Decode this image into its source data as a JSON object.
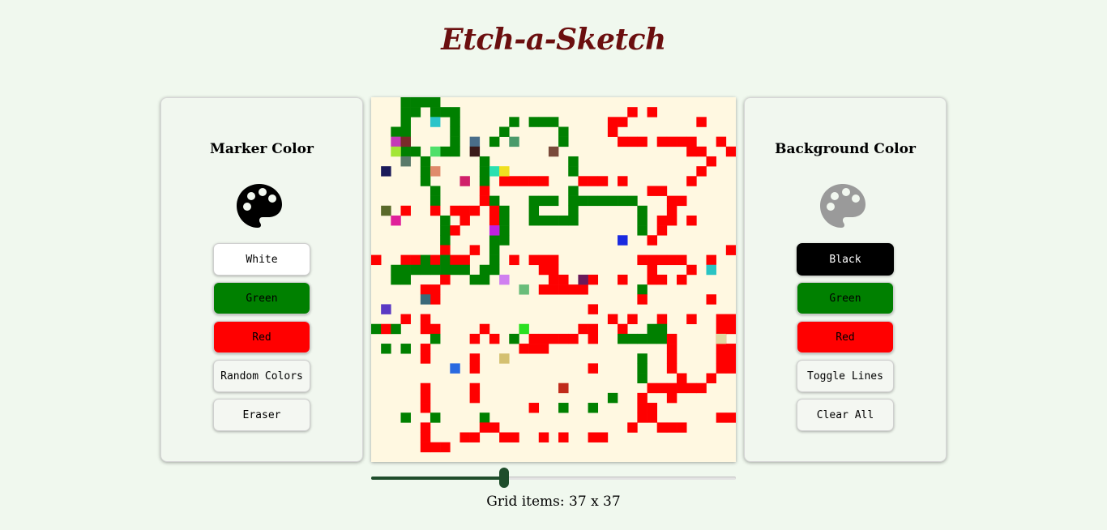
{
  "title": "Etch-a-Sketch",
  "marker_panel": {
    "title": "Marker Color",
    "icon": "palette-icon",
    "icon_color": "#000000",
    "buttons": [
      {
        "label": "White",
        "bg": "#ffffff",
        "fg": "#000000"
      },
      {
        "label": "Green",
        "bg": "#008000",
        "fg": "#000000"
      },
      {
        "label": "Red",
        "bg": "#ff0000",
        "fg": "#000000"
      },
      {
        "label": "Random Colors",
        "bg": "#f4f7f2",
        "fg": "#000000"
      },
      {
        "label": "Eraser",
        "bg": "#f4f7f2",
        "fg": "#000000"
      }
    ]
  },
  "background_panel": {
    "title": "Background Color",
    "icon": "palette-icon",
    "icon_color": "#9a9a9a",
    "buttons": [
      {
        "label": "Black",
        "bg": "#000000",
        "fg": "#ffffff"
      },
      {
        "label": "Green",
        "bg": "#008000",
        "fg": "#000000"
      },
      {
        "label": "Red",
        "bg": "#ff0000",
        "fg": "#000000"
      },
      {
        "label": "Toggle Lines",
        "bg": "#f4f7f2",
        "fg": "#000000"
      },
      {
        "label": "Clear All",
        "bg": "#f4f7f2",
        "fg": "#000000"
      }
    ]
  },
  "canvas": {
    "grid_size": 37,
    "background_color": "#fff8e1",
    "palette": {
      "G": "#008000",
      "R": "#ff0000",
      "W": "#ffffff"
    },
    "painted": [
      [
        0,
        [
          [
            3,
            "GGGG"
          ]
        ]
      ],
      [
        1,
        [
          [
            3,
            "GG"
          ],
          [
            6,
            "GGG"
          ],
          [
            26,
            "R"
          ],
          [
            28,
            "R"
          ]
        ]
      ],
      [
        2,
        [
          [
            3,
            "G"
          ],
          [
            8,
            "G"
          ],
          [
            14,
            "G"
          ],
          [
            16,
            "GGG"
          ],
          [
            24,
            "RR"
          ],
          [
            33,
            "R"
          ]
        ]
      ],
      [
        3,
        [
          [
            2,
            "GG"
          ],
          [
            8,
            "G"
          ],
          [
            13,
            "G"
          ],
          [
            19,
            "G"
          ],
          [
            24,
            "R"
          ]
        ]
      ],
      [
        4,
        [
          [
            3,
            "G"
          ],
          [
            8,
            "G"
          ],
          [
            12,
            "G"
          ],
          [
            19,
            "G"
          ],
          [
            25,
            "RRR"
          ],
          [
            29,
            "RRRR"
          ],
          [
            35,
            "R"
          ]
        ]
      ],
      [
        5,
        [
          [
            3,
            "GG"
          ],
          [
            7,
            "GG"
          ],
          [
            32,
            "RR"
          ],
          [
            36,
            "R"
          ]
        ]
      ],
      [
        6,
        [
          [
            5,
            "G"
          ],
          [
            11,
            "G"
          ],
          [
            20,
            "G"
          ],
          [
            34,
            "R"
          ]
        ]
      ],
      [
        7,
        [
          [
            5,
            "G"
          ],
          [
            11,
            "G"
          ],
          [
            20,
            "G"
          ],
          [
            33,
            "R"
          ]
        ]
      ],
      [
        8,
        [
          [
            5,
            "G"
          ],
          [
            11,
            "G"
          ],
          [
            13,
            "RRRRR"
          ],
          [
            21,
            "RRR"
          ],
          [
            25,
            "R"
          ],
          [
            32,
            "R"
          ]
        ]
      ],
      [
        9,
        [
          [
            6,
            "G"
          ],
          [
            11,
            "R"
          ],
          [
            20,
            "G"
          ],
          [
            28,
            "RR"
          ]
        ]
      ],
      [
        10,
        [
          [
            6,
            "G"
          ],
          [
            11,
            "R"
          ],
          [
            12,
            "G"
          ],
          [
            16,
            "GGG"
          ],
          [
            20,
            "GGGGGGG"
          ],
          [
            30,
            "RR"
          ]
        ]
      ],
      [
        11,
        [
          [
            3,
            "R"
          ],
          [
            6,
            "R"
          ],
          [
            8,
            "RRR"
          ],
          [
            12,
            "R"
          ],
          [
            13,
            "G"
          ],
          [
            16,
            "G"
          ],
          [
            20,
            "G"
          ],
          [
            27,
            "G"
          ],
          [
            30,
            "R"
          ]
        ]
      ],
      [
        12,
        [
          [
            7,
            "G"
          ],
          [
            9,
            "R"
          ],
          [
            12,
            "R"
          ],
          [
            13,
            "G"
          ],
          [
            16,
            "GGGGG"
          ],
          [
            27,
            "G"
          ],
          [
            29,
            "RR"
          ],
          [
            32,
            "R"
          ]
        ]
      ],
      [
        13,
        [
          [
            7,
            "G"
          ],
          [
            8,
            "R"
          ],
          [
            13,
            "G"
          ],
          [
            27,
            "G"
          ],
          [
            29,
            "R"
          ]
        ]
      ],
      [
        14,
        [
          [
            7,
            "G"
          ],
          [
            12,
            "GG"
          ],
          [
            28,
            "R"
          ]
        ]
      ],
      [
        15,
        [
          [
            7,
            "R"
          ],
          [
            10,
            "R"
          ],
          [
            12,
            "G"
          ],
          [
            36,
            "R"
          ]
        ]
      ],
      [
        16,
        [
          [
            0,
            "R"
          ],
          [
            3,
            "RR"
          ],
          [
            5,
            "G"
          ],
          [
            6,
            "R"
          ],
          [
            7,
            "G"
          ],
          [
            8,
            "RR"
          ],
          [
            12,
            "G"
          ],
          [
            14,
            "R"
          ],
          [
            16,
            "RRR"
          ],
          [
            27,
            "RRRRR"
          ],
          [
            34,
            "R"
          ]
        ]
      ],
      [
        17,
        [
          [
            2,
            "GGGGGGGG"
          ],
          [
            11,
            "GG"
          ],
          [
            17,
            "RR"
          ],
          [
            28,
            "R"
          ],
          [
            32,
            "R"
          ]
        ]
      ],
      [
        18,
        [
          [
            2,
            "GG"
          ],
          [
            7,
            "R"
          ],
          [
            10,
            "GG"
          ],
          [
            18,
            "RR"
          ],
          [
            22,
            "R"
          ],
          [
            25,
            "R"
          ],
          [
            28,
            "RR"
          ],
          [
            31,
            "R"
          ]
        ]
      ],
      [
        19,
        [
          [
            5,
            "RR"
          ],
          [
            17,
            "RRRRR"
          ],
          [
            27,
            "G"
          ]
        ]
      ],
      [
        20,
        [
          [
            6,
            "R"
          ],
          [
            27,
            "R"
          ],
          [
            34,
            "R"
          ]
        ]
      ],
      [
        21,
        [
          [
            22,
            "R"
          ]
        ]
      ],
      [
        22,
        [
          [
            3,
            "R"
          ],
          [
            5,
            "R"
          ],
          [
            24,
            "R"
          ],
          [
            26,
            "R"
          ],
          [
            29,
            "R"
          ],
          [
            32,
            "R"
          ],
          [
            35,
            "RR"
          ]
        ]
      ],
      [
        23,
        [
          [
            0,
            "G"
          ],
          [
            1,
            "R"
          ],
          [
            2,
            "G"
          ],
          [
            5,
            "RR"
          ],
          [
            11,
            "R"
          ],
          [
            21,
            "RR"
          ],
          [
            25,
            "R"
          ],
          [
            28,
            "GG"
          ],
          [
            35,
            "RR"
          ]
        ]
      ],
      [
        24,
        [
          [
            6,
            "G"
          ],
          [
            10,
            "R"
          ],
          [
            12,
            "R"
          ],
          [
            14,
            "G"
          ],
          [
            16,
            "RRRRR"
          ],
          [
            22,
            "R"
          ],
          [
            25,
            "GGGGG"
          ],
          [
            30,
            "R"
          ],
          [
            35,
            "R"
          ]
        ]
      ],
      [
        25,
        [
          [
            1,
            "G"
          ],
          [
            3,
            "G"
          ],
          [
            5,
            "R"
          ],
          [
            15,
            "RRR"
          ],
          [
            30,
            "R"
          ],
          [
            35,
            "RR"
          ]
        ]
      ],
      [
        26,
        [
          [
            5,
            "R"
          ],
          [
            10,
            "R"
          ],
          [
            27,
            "G"
          ],
          [
            30,
            "R"
          ],
          [
            35,
            "RR"
          ]
        ]
      ],
      [
        27,
        [
          [
            10,
            "R"
          ],
          [
            22,
            "R"
          ],
          [
            27,
            "G"
          ],
          [
            30,
            "R"
          ],
          [
            35,
            "RR"
          ]
        ]
      ],
      [
        28,
        [
          [
            27,
            "G"
          ],
          [
            31,
            "R"
          ],
          [
            34,
            "R"
          ]
        ]
      ],
      [
        29,
        [
          [
            5,
            "R"
          ],
          [
            10,
            "R"
          ],
          [
            28,
            "RRRRRR"
          ]
        ]
      ],
      [
        30,
        [
          [
            5,
            "R"
          ],
          [
            10,
            "R"
          ],
          [
            24,
            "G"
          ],
          [
            27,
            "R"
          ],
          [
            30,
            "R"
          ]
        ]
      ],
      [
        31,
        [
          [
            5,
            "R"
          ],
          [
            16,
            "R"
          ],
          [
            19,
            "G"
          ],
          [
            22,
            "G"
          ],
          [
            27,
            "RR"
          ]
        ]
      ],
      [
        32,
        [
          [
            3,
            "G"
          ],
          [
            6,
            "G"
          ],
          [
            11,
            "G"
          ],
          [
            27,
            "RR"
          ],
          [
            35,
            "RR"
          ]
        ]
      ],
      [
        33,
        [
          [
            5,
            "R"
          ],
          [
            11,
            "RR"
          ],
          [
            26,
            "R"
          ],
          [
            29,
            "RRR"
          ]
        ]
      ],
      [
        34,
        [
          [
            5,
            "R"
          ],
          [
            9,
            "RR"
          ],
          [
            13,
            "RR"
          ],
          [
            17,
            "R"
          ],
          [
            19,
            "R"
          ],
          [
            22,
            "RR"
          ]
        ]
      ],
      [
        35,
        [
          [
            5,
            "RRR"
          ]
        ]
      ]
    ],
    "accent_cells": [
      [
        2,
        6,
        "#2bc4c9"
      ],
      [
        4,
        2,
        "#c43ab8"
      ],
      [
        4,
        3,
        "#7a2a2a"
      ],
      [
        4,
        10,
        "#4a6e8a"
      ],
      [
        4,
        14,
        "#4a9a6a"
      ],
      [
        5,
        2,
        "#a3e635"
      ],
      [
        5,
        6,
        "#4ee06a"
      ],
      [
        5,
        10,
        "#3a1a1a"
      ],
      [
        5,
        18,
        "#7a4a3a"
      ],
      [
        6,
        3,
        "#5a7a6a"
      ],
      [
        7,
        1,
        "#1a1a5a"
      ],
      [
        7,
        6,
        "#e08a6a"
      ],
      [
        7,
        12,
        "#2ae0b0"
      ],
      [
        7,
        13,
        "#f0e020"
      ],
      [
        8,
        9,
        "#d0206a"
      ],
      [
        11,
        1,
        "#5a6a2a"
      ],
      [
        12,
        2,
        "#e0209a"
      ],
      [
        13,
        12,
        "#c020e0"
      ],
      [
        14,
        25,
        "#1a2ae0"
      ],
      [
        17,
        34,
        "#2ac4c4"
      ],
      [
        18,
        13,
        "#d080f0"
      ],
      [
        18,
        21,
        "#6a1a5a"
      ],
      [
        19,
        15,
        "#6abd7a"
      ],
      [
        20,
        5,
        "#3a6a7a"
      ],
      [
        21,
        1,
        "#5a3ac4"
      ],
      [
        23,
        15,
        "#2ae020"
      ],
      [
        24,
        35,
        "#e0d8a0"
      ],
      [
        26,
        13,
        "#d4c070"
      ],
      [
        27,
        8,
        "#2a6ae0"
      ],
      [
        29,
        19,
        "#c02a1a"
      ]
    ]
  },
  "slider": {
    "min": 1,
    "max": 100,
    "value": 37
  },
  "grid_info": "Grid items: 37 x 37"
}
